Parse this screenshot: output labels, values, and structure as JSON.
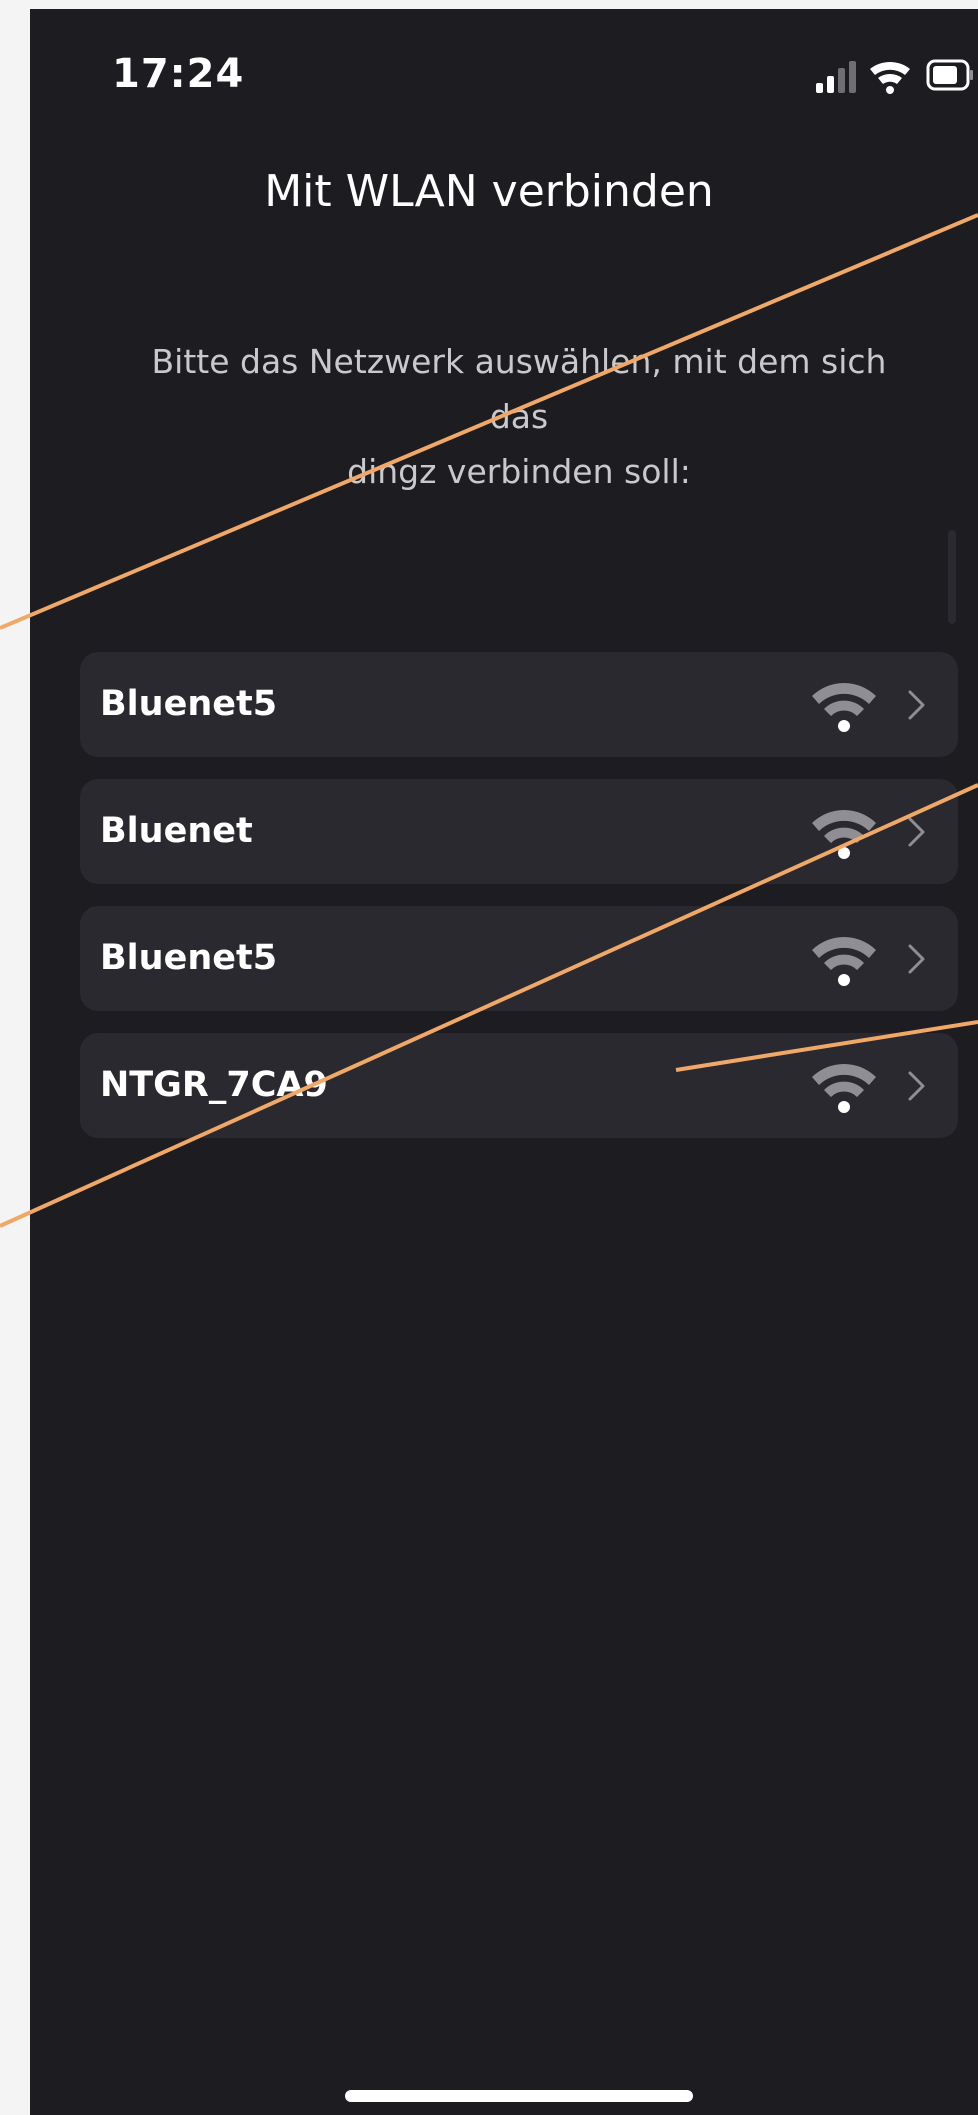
{
  "status_bar": {
    "time": "17:24",
    "icons": [
      "cellular-signal-icon",
      "wifi-icon",
      "battery-icon"
    ]
  },
  "header": {
    "title": "Mit WLAN verbinden",
    "subtitle": "Bitte das Netzwerk auswählen, mit dem sich das\ndingz verbinden soll:"
  },
  "networks": [
    {
      "name": "Bluenet5",
      "icon": "wifi-signal-icon"
    },
    {
      "name": "Bluenet",
      "icon": "wifi-signal-icon"
    },
    {
      "name": "Bluenet5",
      "icon": "wifi-signal-icon"
    },
    {
      "name": "NTGR_7CA9",
      "icon": "wifi-signal-icon"
    }
  ],
  "colors": {
    "background": "#1d1c21",
    "row": "#29292f",
    "text": "#ffffff",
    "subtext": "#c9c9cc",
    "icon": "#8e8e93",
    "annotation": "#f0a868"
  }
}
